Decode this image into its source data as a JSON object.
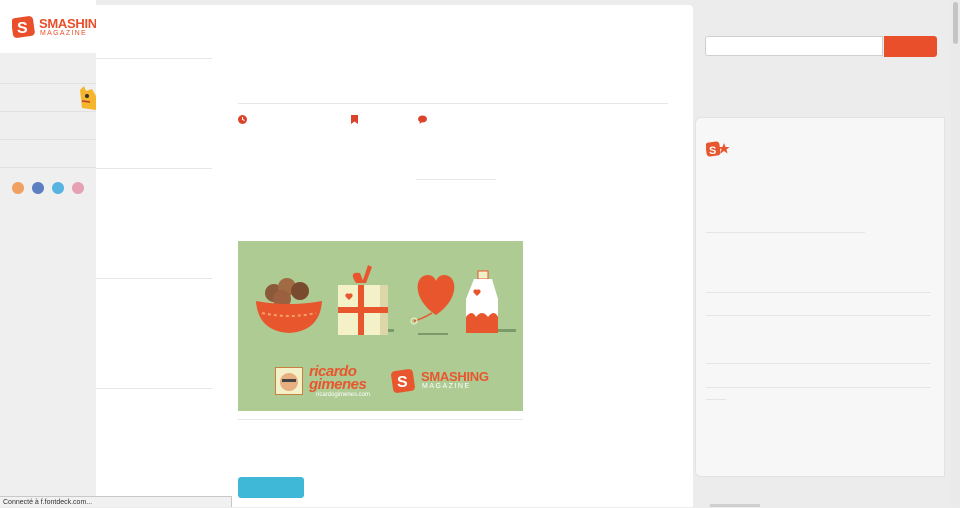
{
  "brand": {
    "name": "SMASHING",
    "tagline": "MAGAZINE",
    "accent_color": "#e84f2a"
  },
  "search": {
    "placeholder": "",
    "button_color": "#e84f2a"
  },
  "social_links": [
    {
      "icon": "rss-icon",
      "color": "#f0a060"
    },
    {
      "icon": "facebook-icon",
      "color": "#5b7fc0"
    },
    {
      "icon": "twitter-icon",
      "color": "#55b5e0"
    },
    {
      "icon": "email-icon",
      "color": "#e6a0b4"
    }
  ],
  "article_meta": {
    "icons": [
      "clock-icon",
      "bookmark-icon",
      "comment-icon"
    ]
  },
  "feature_image": {
    "credit_name_line1": "ricardo",
    "credit_name_line2": "gimenes",
    "credit_url": "ricardogimenes.com",
    "brand_name": "SMASHING",
    "brand_tagline": "MAGAZINE",
    "background_color": "#aecb94"
  },
  "cta": {
    "color": "#3fb8d8"
  },
  "status_bar": {
    "text": "Connecté à f.fontdeck.com..."
  }
}
